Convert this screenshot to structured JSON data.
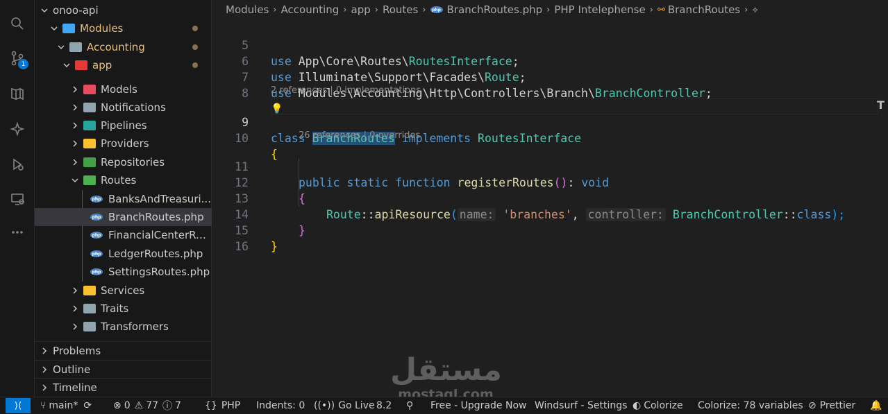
{
  "explorer": {
    "root": "onoo-api",
    "modules": "Modules",
    "accounting": "Accounting",
    "app": "app",
    "items": [
      "Models",
      "Notifications",
      "Pipelines",
      "Providers",
      "Repositories",
      "Routes"
    ],
    "route_files": [
      "BanksAndTreasuri...",
      "BranchRoutes.php",
      "FinancialCenterRo...",
      "LedgerRoutes.php",
      "SettingsRoutes.php"
    ],
    "after_items": [
      "Services",
      "Traits",
      "Transformers"
    ],
    "source_control_badge": "1",
    "folder_colors": {
      "models": "#e84a5f",
      "notifications": "#90a4ae",
      "pipelines": "#26a69a",
      "providers": "#fbc02d",
      "repositories": "#43a047",
      "routes": "#4caf50",
      "services": "#fbc02d",
      "traits": "#90a4ae",
      "transformers": "#90a4ae",
      "modules": "#42a5f5",
      "accounting": "#90a4ae",
      "app": "#e53935"
    }
  },
  "panels": [
    "Problems",
    "Outline",
    "Timeline"
  ],
  "breadcrumb": [
    "Modules",
    "Accounting",
    "app",
    "Routes",
    "BranchRoutes.php",
    "PHP Intelephense",
    "BranchRoutes"
  ],
  "editor": {
    "line_numbers": [
      "5",
      "6",
      "7",
      "8",
      "9",
      "10",
      "11",
      "12",
      "13",
      "14",
      "15",
      "16"
    ],
    "line5": {
      "kw": "use",
      "path": " App\\Core\\Routes\\",
      "cls": "RoutesInterface",
      "end": ";"
    },
    "line6": {
      "kw": "use",
      "path": " Illuminate\\Support\\Facades\\",
      "cls": "Route",
      "end": ";"
    },
    "line7": {
      "kw": "use",
      "path": " Modules\\Accounting\\Http\\Controllers\\Branch\\",
      "cls": "BranchController",
      "end": ";"
    },
    "codelens1": "2 references | 0 implementations",
    "line9": {
      "kw1": "class",
      "name": "BranchRoutes",
      "kw2": "implements",
      "iface": "RoutesInterface"
    },
    "line10": "{",
    "codelens2": "26 references | 0 overrides",
    "line11": {
      "kw1": "public",
      "kw2": "static",
      "kw3": "function",
      "fn": "registerRoutes",
      "paren": "()",
      "colon": ": ",
      "ret": "void"
    },
    "line12": "{",
    "line13": {
      "cls": "Route",
      "op": "::",
      "fn": "apiResource",
      "open": "(",
      "hint1": "name:",
      "str": "'branches'",
      "comma": ", ",
      "hint2": "controller:",
      "cls2": "BranchController",
      "op2": "::",
      "kw": "class",
      "close": ");"
    },
    "line14": "}",
    "line15": "}"
  },
  "status_bar": {
    "branch": "main*",
    "errors": "0",
    "warnings": "77",
    "infos": "7",
    "language": "PHP",
    "indents": "Indents: 0",
    "go_live": "Go Live",
    "php_version": "8.2",
    "windsurf_free": "Free - Upgrade Now",
    "windsurf_settings": "Windsurf - Settings",
    "colorize": "Colorize",
    "colorize_vars": "Colorize: 78 variables",
    "prettier": "Prettier"
  },
  "watermark": {
    "arabic": "مستقل",
    "latin": "mostaql.com"
  }
}
